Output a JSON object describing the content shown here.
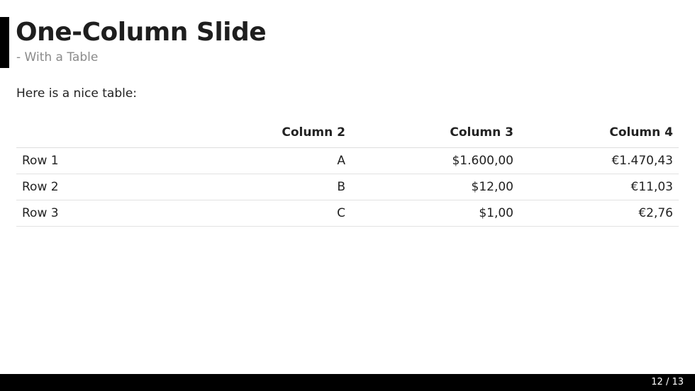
{
  "slide": {
    "title": "One-Column Slide",
    "subtitle": "- With a Table",
    "intro": "Here is a nice table:"
  },
  "table": {
    "headers": [
      "",
      "Column 2",
      "Column 3",
      "Column 4"
    ],
    "rows": [
      [
        "Row 1",
        "A",
        "$1.600,00",
        "€1.470,43"
      ],
      [
        "Row 2",
        "B",
        "$12,00",
        "€11,03"
      ],
      [
        "Row 3",
        "C",
        "$1,00",
        "€2,76"
      ]
    ]
  },
  "footer": {
    "page_counter": "12 / 13"
  },
  "colors": {
    "accent": "#000000",
    "footer_background": "#000000",
    "subtitle": "#8a8a8a"
  }
}
